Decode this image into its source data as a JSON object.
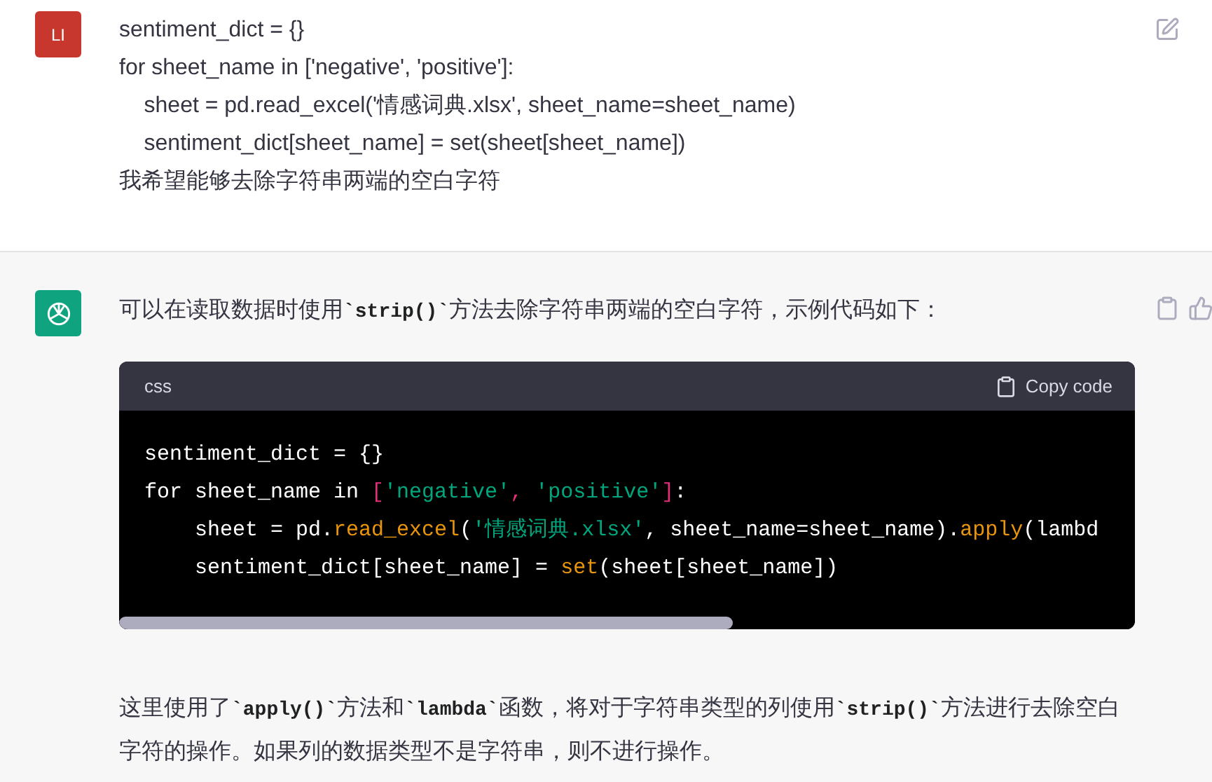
{
  "user_message": {
    "avatar": "LI",
    "lines": [
      "sentiment_dict = {}",
      "for sheet_name in ['negative', 'positive']:",
      "    sheet = pd.read_excel('情感词典.xlsx', sheet_name=sheet_name)",
      "    sentiment_dict[sheet_name] = set(sheet[sheet_name])",
      "我希望能够去除字符串两端的空白字符"
    ]
  },
  "assistant_message": {
    "intro": [
      {
        "kind": "text",
        "text": "可以在读取数据时使用"
      },
      {
        "kind": "code",
        "text": "`strip()`"
      },
      {
        "kind": "text",
        "text": "方法去除字符串两端的空白字符，示例代码如下："
      }
    ],
    "code_block": {
      "language": "css",
      "copy_label": "Copy code",
      "lines": [
        [
          {
            "kind": "plain",
            "text": "sentiment_dict = {}"
          }
        ],
        [
          {
            "kind": "plain",
            "text": "for sheet_name in "
          },
          {
            "kind": "punct",
            "text": "["
          },
          {
            "kind": "string",
            "text": "'negative'"
          },
          {
            "kind": "punct",
            "text": ", "
          },
          {
            "kind": "string",
            "text": "'positive'"
          },
          {
            "kind": "punct",
            "text": "]"
          },
          {
            "kind": "plain",
            "text": ":"
          }
        ],
        [
          {
            "kind": "plain",
            "text": "    sheet = pd."
          },
          {
            "kind": "call",
            "text": "read_excel"
          },
          {
            "kind": "plain",
            "text": "("
          },
          {
            "kind": "string",
            "text": "'情感词典.xlsx'"
          },
          {
            "kind": "plain",
            "text": ", sheet_name=sheet_name)."
          },
          {
            "kind": "call",
            "text": "apply"
          },
          {
            "kind": "plain",
            "text": "(lambd"
          }
        ],
        [
          {
            "kind": "plain",
            "text": "    sentiment_dict[sheet_name] = "
          },
          {
            "kind": "call",
            "text": "set"
          },
          {
            "kind": "plain",
            "text": "(sheet[sheet_name])"
          }
        ]
      ]
    },
    "outro": [
      {
        "kind": "text",
        "text": "这里使用了"
      },
      {
        "kind": "code",
        "text": "`apply()`"
      },
      {
        "kind": "text",
        "text": "方法和"
      },
      {
        "kind": "code",
        "text": "`lambda`"
      },
      {
        "kind": "text",
        "text": "函数，将对于字符串类型的列使用"
      },
      {
        "kind": "code",
        "text": "`strip()`"
      },
      {
        "kind": "text",
        "text": "方法进行去除空白字符的操作。如果列的数据类型不是字符串，则不进行操作。"
      }
    ]
  }
}
